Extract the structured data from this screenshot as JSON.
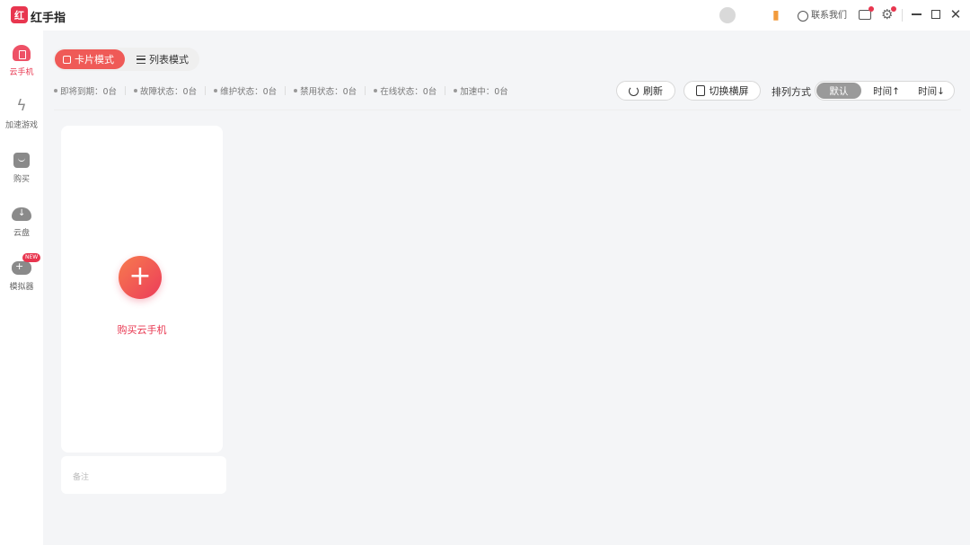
{
  "app": {
    "logo_text": "红",
    "name": "红手指"
  },
  "titlebar": {
    "contact_label": "联系我们",
    "gear_icon": "gear-icon",
    "close_glyph": "✕"
  },
  "sidebar": {
    "items": [
      {
        "label": "云手机",
        "icon": "cloud-phone-icon",
        "active": true
      },
      {
        "label": "加速游戏",
        "icon": "bolt-icon"
      },
      {
        "label": "购买",
        "icon": "shopping-bag-icon"
      },
      {
        "label": "云盘",
        "icon": "cloud-download-icon"
      },
      {
        "label": "模拟器",
        "icon": "gamepad-icon",
        "badge": "NEW"
      }
    ]
  },
  "mode": {
    "card_label": "卡片模式",
    "list_label": "列表模式"
  },
  "status": [
    {
      "label": "即将到期：0台"
    },
    {
      "label": "故障状态：0台"
    },
    {
      "label": "维护状态：0台"
    },
    {
      "label": "禁用状态：0台"
    },
    {
      "label": "在线状态：0台"
    },
    {
      "label": "加速中：0台"
    }
  ],
  "actions": {
    "refresh_label": "刷新",
    "switch_label": "切换横屏"
  },
  "sort": {
    "label": "排列方式",
    "options": [
      "默认",
      "时间↑",
      "时间↓"
    ]
  },
  "card": {
    "add_glyph": "+",
    "caption": "购买云手机",
    "footer_text": "备注"
  },
  "colors": {
    "accent": "#e8364f",
    "accent_gradient_start": "#f77b4e"
  }
}
